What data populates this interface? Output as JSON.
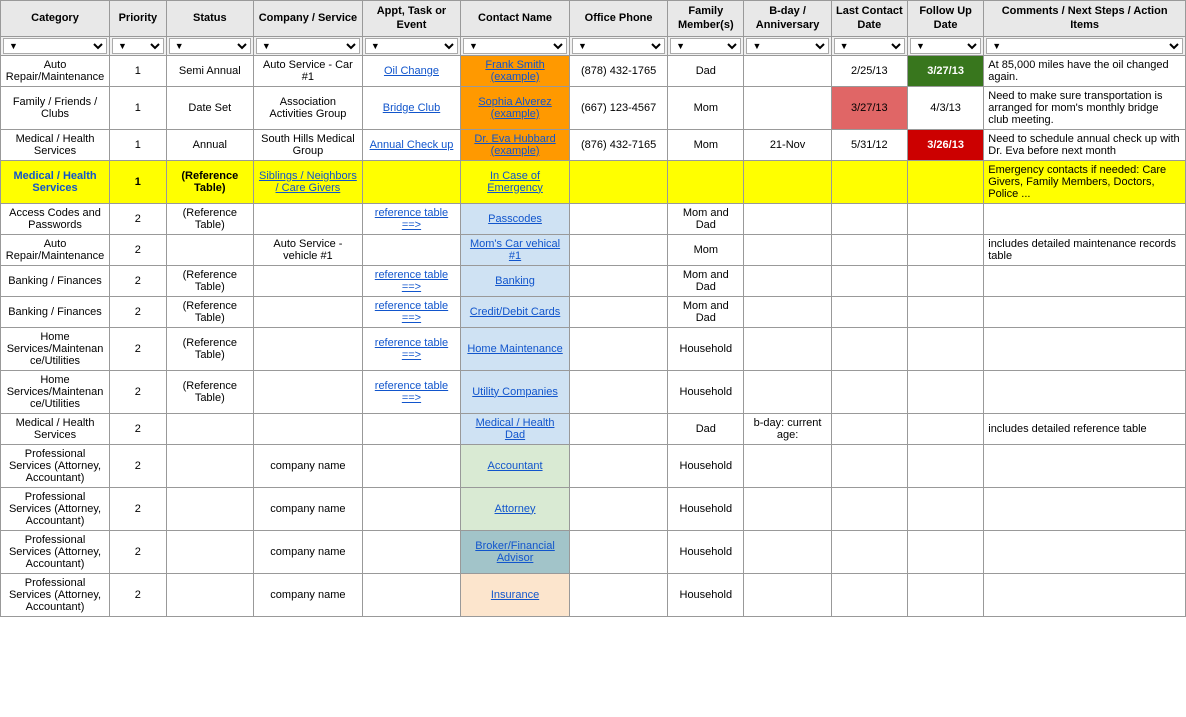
{
  "columns": [
    {
      "id": "category",
      "label": "Category",
      "class": "col-category"
    },
    {
      "id": "priority",
      "label": "Priority",
      "class": "col-priority"
    },
    {
      "id": "status",
      "label": "Status",
      "class": "col-status"
    },
    {
      "id": "company",
      "label": "Company / Service",
      "class": "col-company"
    },
    {
      "id": "appt",
      "label": "Appt, Task or Event",
      "class": "col-appt"
    },
    {
      "id": "contact",
      "label": "Contact Name",
      "class": "col-contact"
    },
    {
      "id": "phone",
      "label": "Office Phone",
      "class": "col-phone"
    },
    {
      "id": "family",
      "label": "Family Member(s)",
      "class": "col-family"
    },
    {
      "id": "bday",
      "label": "B-day / Anniversary",
      "class": "col-bday"
    },
    {
      "id": "lastcontact",
      "label": "Last Contact Date",
      "class": "col-lastcontact"
    },
    {
      "id": "followup",
      "label": "Follow Up Date",
      "class": "col-followup"
    },
    {
      "id": "comments",
      "label": "Comments / Next Steps / Action Items",
      "class": "col-comments"
    }
  ],
  "rows": [
    {
      "category": "Auto Repair/Maintenance",
      "priority": "1",
      "status": "Semi Annual",
      "company": "Auto Service - Car #1",
      "appt": "Oil Change",
      "appt_link": true,
      "contact": "Frank Smith  (example)",
      "contact_link": true,
      "contact_highlight": "orange",
      "phone": "(878) 432-1765",
      "family": "Dad",
      "bday": "",
      "lastcontact": "2/25/13",
      "followup": "3/27/13",
      "followup_highlight": "green",
      "comments": "At 85,000 miles have the oil changed again."
    },
    {
      "category": "Family / Friends / Clubs",
      "priority": "1",
      "status": "Date Set",
      "company": "Association Activities Group",
      "appt": "Bridge Club",
      "appt_link": true,
      "contact": "Sophia Alverez  (example)",
      "contact_link": true,
      "contact_highlight": "orange",
      "phone": "(667) 123-4567",
      "family": "Mom",
      "bday": "",
      "lastcontact": "3/27/13",
      "lastcontact_highlight": "red_orange",
      "followup": "4/3/13",
      "comments": "Need to make sure transportation is arranged for mom's monthly bridge club meeting."
    },
    {
      "category": "Medical / Health Services",
      "priority": "1",
      "status": "Annual",
      "company": "South Hills Medical Group",
      "appt": "Annual Check up",
      "appt_link": true,
      "contact": "Dr. Eva Hubbard  (example)",
      "contact_link": true,
      "contact_highlight": "orange",
      "phone": "(876) 432-7165",
      "family": "Mom",
      "bday": "21-Nov",
      "lastcontact": "5/31/12",
      "followup": "3/26/13",
      "followup_highlight": "dark_red",
      "comments": "Need to schedule annual check up with Dr. Eva before next month"
    },
    {
      "category": "Medical / Health Services",
      "priority": "1",
      "status": "(Reference Table)",
      "company": "Siblings / Neighbors / Care Givers",
      "company_link": true,
      "appt": "",
      "contact": "In Case of Emergency",
      "contact_link": true,
      "contact_highlight": "none",
      "phone": "",
      "family": "",
      "bday": "",
      "lastcontact": "",
      "followup": "",
      "comments": "Emergency contacts if needed: Care Givers, Family Members, Doctors, Police ...",
      "row_highlight": "yellow"
    },
    {
      "category": "Access Codes and Passwords",
      "priority": "2",
      "status": "(Reference Table)",
      "company": "",
      "appt": "reference table ==>",
      "appt_link": true,
      "contact": "Passcodes",
      "contact_link": true,
      "contact_highlight": "light_blue",
      "phone": "",
      "family": "Mom and Dad",
      "bday": "",
      "lastcontact": "",
      "followup": "",
      "comments": ""
    },
    {
      "category": "Auto Repair/Maintenance",
      "priority": "2",
      "status": "",
      "company": "Auto Service - vehicle #1",
      "appt": "",
      "contact": "Mom's Car vehical #1",
      "contact_link": true,
      "contact_highlight": "light_blue",
      "phone": "",
      "family": "Mom",
      "bday": "",
      "lastcontact": "",
      "followup": "",
      "comments": "includes detailed maintenance records table"
    },
    {
      "category": "Banking / Finances",
      "priority": "2",
      "status": "(Reference Table)",
      "company": "",
      "appt": "reference table ==>",
      "appt_link": true,
      "contact": "Banking",
      "contact_link": true,
      "contact_highlight": "light_blue",
      "phone": "",
      "family": "Mom and Dad",
      "bday": "",
      "lastcontact": "",
      "followup": "",
      "comments": ""
    },
    {
      "category": "Banking / Finances",
      "priority": "2",
      "status": "(Reference Table)",
      "company": "",
      "appt": "reference table ==>",
      "appt_link": true,
      "contact": "Credit/Debit Cards",
      "contact_link": true,
      "contact_highlight": "light_blue",
      "phone": "",
      "family": "Mom and Dad",
      "bday": "",
      "lastcontact": "",
      "followup": "",
      "comments": ""
    },
    {
      "category": "Home Services/Maintenance/Utilities",
      "priority": "2",
      "status": "(Reference Table)",
      "company": "",
      "appt": "reference table ==>",
      "appt_link": true,
      "contact": "Home Maintenance",
      "contact_link": true,
      "contact_highlight": "light_blue",
      "phone": "",
      "family": "Household",
      "bday": "",
      "lastcontact": "",
      "followup": "",
      "comments": ""
    },
    {
      "category": "Home Services/Maintenance/Utilities",
      "priority": "2",
      "status": "(Reference Table)",
      "company": "",
      "appt": "reference table ==>",
      "appt_link": true,
      "contact": "Utility Companies",
      "contact_link": true,
      "contact_highlight": "light_blue",
      "phone": "",
      "family": "Household",
      "bday": "",
      "lastcontact": "",
      "followup": "",
      "comments": ""
    },
    {
      "category": "Medical / Health Services",
      "priority": "2",
      "status": "",
      "company": "",
      "appt": "",
      "contact": "Medical / Health Dad",
      "contact_link": true,
      "contact_highlight": "light_blue",
      "phone": "",
      "family": "Dad",
      "bday": "b-day: current age:",
      "lastcontact": "",
      "followup": "",
      "comments": "includes detailed reference table"
    },
    {
      "category": "Professional Services (Attorney, Accountant)",
      "priority": "2",
      "status": "",
      "company": "company name",
      "appt": "",
      "contact": "Accountant",
      "contact_link": true,
      "contact_highlight": "light_green",
      "phone": "",
      "family": "Household",
      "bday": "",
      "lastcontact": "",
      "followup": "",
      "comments": ""
    },
    {
      "category": "Professional Services (Attorney, Accountant)",
      "priority": "2",
      "status": "",
      "company": "company name",
      "appt": "",
      "contact": "Attorney",
      "contact_link": true,
      "contact_highlight": "light_green",
      "phone": "",
      "family": "Household",
      "bday": "",
      "lastcontact": "",
      "followup": "",
      "comments": ""
    },
    {
      "category": "Professional Services (Attorney, Accountant)",
      "priority": "2",
      "status": "",
      "company": "company name",
      "appt": "",
      "contact": "Broker/Financial Advisor",
      "contact_link": true,
      "contact_highlight": "teal",
      "phone": "",
      "family": "Household",
      "bday": "",
      "lastcontact": "",
      "followup": "",
      "comments": ""
    },
    {
      "category": "Professional Services (Attorney, Accountant)",
      "priority": "2",
      "status": "",
      "company": "company name",
      "appt": "",
      "contact": "Insurance",
      "contact_link": true,
      "contact_highlight": "light_orange",
      "phone": "",
      "family": "Household",
      "bday": "",
      "lastcontact": "",
      "followup": "",
      "comments": ""
    }
  ]
}
